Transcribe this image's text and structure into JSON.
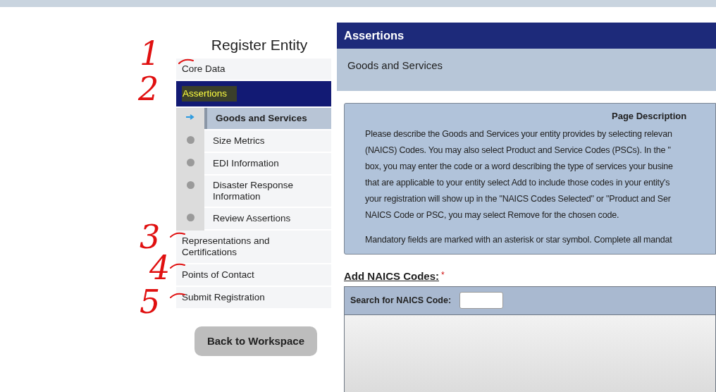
{
  "sidebar": {
    "title": "Register Entity",
    "items": [
      {
        "label": "Core Data",
        "selected": false,
        "highlighted": false
      },
      {
        "label": "Assertions",
        "selected": true,
        "highlighted": true,
        "children": [
          {
            "label": "Goods and Services",
            "selected": true
          },
          {
            "label": "Size Metrics",
            "selected": false
          },
          {
            "label": "EDI Information",
            "selected": false
          },
          {
            "label": "Disaster Response Information",
            "selected": false
          },
          {
            "label": "Review Assertions",
            "selected": false
          }
        ]
      },
      {
        "label": "Representations and Certifications",
        "selected": false,
        "highlighted": false
      },
      {
        "label": "Points of Contact",
        "selected": false,
        "highlighted": false
      },
      {
        "label": "Submit Registration",
        "selected": false,
        "highlighted": false
      }
    ]
  },
  "back_button": "Back to Workspace",
  "main": {
    "header": "Assertions",
    "subheader": "Goods and Services",
    "description": {
      "title": "Page Description",
      "lines": [
        "Please describe the Goods and Services your entity provides by selecting relevan",
        "(NAICS) Codes. You may also select Product and Service Codes (PSCs). In the \"",
        "box, you may enter the code or a word describing the type of services your busine",
        "that are applicable to your entity select Add to include those codes in your entity's",
        "your registration will show up in the \"NAICS Codes Selected\" or \"Product and Ser",
        "NAICS Code or PSC, you may select Remove for the chosen code."
      ],
      "note": "Mandatory fields are marked with an asterisk or star symbol. Complete all mandat"
    },
    "naics": {
      "heading": "Add NAICS Codes:",
      "required_mark": "*",
      "search_label": "Search for NAICS Code:"
    }
  },
  "annotations": [
    {
      "label": "1"
    },
    {
      "label": "2"
    },
    {
      "label": "3"
    },
    {
      "label": "4"
    },
    {
      "label": "5"
    }
  ]
}
